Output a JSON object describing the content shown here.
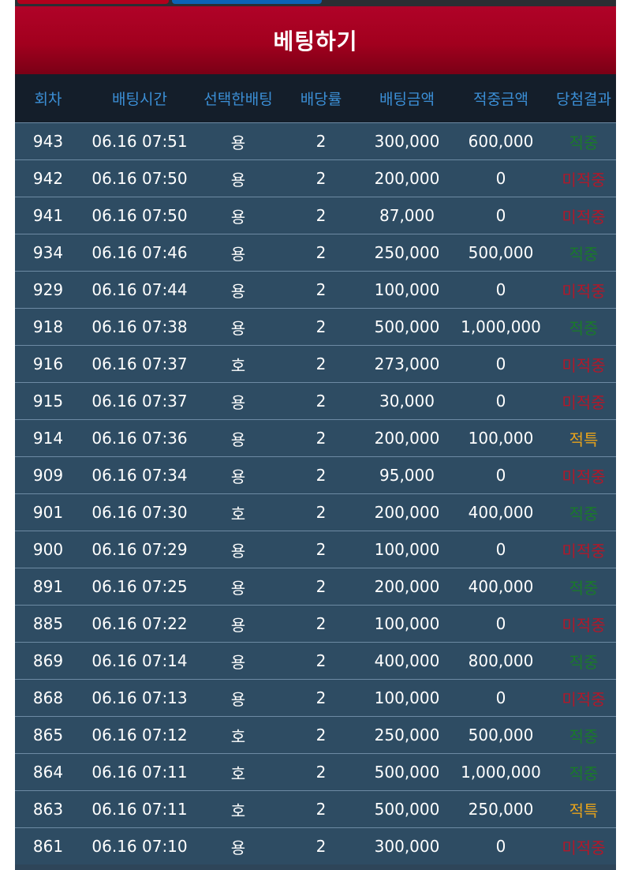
{
  "header": {
    "title": "베팅하기"
  },
  "table": {
    "columns": [
      "회차",
      "배팅시간",
      "선택한배팅",
      "배당률",
      "배팅금액",
      "적중금액",
      "당첨결과"
    ],
    "rows": [
      {
        "round": "943",
        "time": "06.16 07:51",
        "pick": "용",
        "odds": "2",
        "bet": "300,000",
        "payout": "600,000",
        "result": "적중",
        "result_type": "win"
      },
      {
        "round": "942",
        "time": "06.16 07:50",
        "pick": "용",
        "odds": "2",
        "bet": "200,000",
        "payout": "0",
        "result": "미적중",
        "result_type": "lose"
      },
      {
        "round": "941",
        "time": "06.16 07:50",
        "pick": "용",
        "odds": "2",
        "bet": "87,000",
        "payout": "0",
        "result": "미적중",
        "result_type": "lose"
      },
      {
        "round": "934",
        "time": "06.16 07:46",
        "pick": "용",
        "odds": "2",
        "bet": "250,000",
        "payout": "500,000",
        "result": "적중",
        "result_type": "win"
      },
      {
        "round": "929",
        "time": "06.16 07:44",
        "pick": "용",
        "odds": "2",
        "bet": "100,000",
        "payout": "0",
        "result": "미적중",
        "result_type": "lose"
      },
      {
        "round": "918",
        "time": "06.16 07:38",
        "pick": "용",
        "odds": "2",
        "bet": "500,000",
        "payout": "1,000,000",
        "result": "적중",
        "result_type": "win"
      },
      {
        "round": "916",
        "time": "06.16 07:37",
        "pick": "호",
        "odds": "2",
        "bet": "273,000",
        "payout": "0",
        "result": "미적중",
        "result_type": "lose"
      },
      {
        "round": "915",
        "time": "06.16 07:37",
        "pick": "용",
        "odds": "2",
        "bet": "30,000",
        "payout": "0",
        "result": "미적중",
        "result_type": "lose"
      },
      {
        "round": "914",
        "time": "06.16 07:36",
        "pick": "용",
        "odds": "2",
        "bet": "200,000",
        "payout": "100,000",
        "result": "적특",
        "result_type": "special"
      },
      {
        "round": "909",
        "time": "06.16 07:34",
        "pick": "용",
        "odds": "2",
        "bet": "95,000",
        "payout": "0",
        "result": "미적중",
        "result_type": "lose"
      },
      {
        "round": "901",
        "time": "06.16 07:30",
        "pick": "호",
        "odds": "2",
        "bet": "200,000",
        "payout": "400,000",
        "result": "적중",
        "result_type": "win"
      },
      {
        "round": "900",
        "time": "06.16 07:29",
        "pick": "용",
        "odds": "2",
        "bet": "100,000",
        "payout": "0",
        "result": "미적중",
        "result_type": "lose"
      },
      {
        "round": "891",
        "time": "06.16 07:25",
        "pick": "용",
        "odds": "2",
        "bet": "200,000",
        "payout": "400,000",
        "result": "적중",
        "result_type": "win"
      },
      {
        "round": "885",
        "time": "06.16 07:22",
        "pick": "용",
        "odds": "2",
        "bet": "100,000",
        "payout": "0",
        "result": "미적중",
        "result_type": "lose"
      },
      {
        "round": "869",
        "time": "06.16 07:14",
        "pick": "용",
        "odds": "2",
        "bet": "400,000",
        "payout": "800,000",
        "result": "적중",
        "result_type": "win"
      },
      {
        "round": "868",
        "time": "06.16 07:13",
        "pick": "용",
        "odds": "2",
        "bet": "100,000",
        "payout": "0",
        "result": "미적중",
        "result_type": "lose"
      },
      {
        "round": "865",
        "time": "06.16 07:12",
        "pick": "호",
        "odds": "2",
        "bet": "250,000",
        "payout": "500,000",
        "result": "적중",
        "result_type": "win"
      },
      {
        "round": "864",
        "time": "06.16 07:11",
        "pick": "호",
        "odds": "2",
        "bet": "500,000",
        "payout": "1,000,000",
        "result": "적중",
        "result_type": "win"
      },
      {
        "round": "863",
        "time": "06.16 07:11",
        "pick": "호",
        "odds": "2",
        "bet": "500,000",
        "payout": "250,000",
        "result": "적특",
        "result_type": "special"
      },
      {
        "round": "861",
        "time": "06.16 07:10",
        "pick": "용",
        "odds": "2",
        "bet": "300,000",
        "payout": "0",
        "result": "미적중",
        "result_type": "lose"
      }
    ]
  },
  "colors": {
    "header_red": "#a2001e",
    "table_header_bg": "#141e2a",
    "table_header_text": "#3b8fd6",
    "row_bg": "#2e4c63",
    "win": "#1a7a2a",
    "lose": "#b1182a",
    "special": "#e8a31b"
  }
}
